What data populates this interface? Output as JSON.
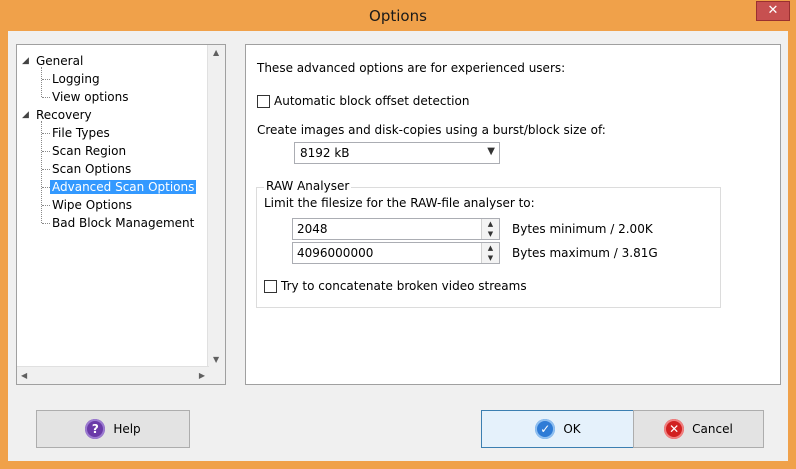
{
  "window": {
    "title": "Options",
    "close_glyph": "✕"
  },
  "tree": {
    "items": [
      {
        "label": "General",
        "expanded": true
      },
      {
        "label": "Logging"
      },
      {
        "label": "View options"
      },
      {
        "label": "Recovery",
        "expanded": true
      },
      {
        "label": "File Types"
      },
      {
        "label": "Scan Region"
      },
      {
        "label": "Scan Options"
      },
      {
        "label": "Advanced Scan Options",
        "selected": true
      },
      {
        "label": "Wipe Options"
      },
      {
        "label": "Bad Block Management"
      }
    ]
  },
  "panel": {
    "intro": "These advanced options are for experienced users:",
    "auto_offset": {
      "label": "Automatic block offset detection",
      "checked": false
    },
    "burst_label": "Create images and disk-copies using a burst/block size of:",
    "burst_value": "8192 kB",
    "raw": {
      "title": "RAW Analyser",
      "limit_label": "Limit the filesize for the RAW-file analyser to:",
      "min_value": "2048",
      "min_label": "Bytes minimum / 2.00K",
      "max_value": "4096000000",
      "max_label": "Bytes maximum / 3.81G",
      "concat": {
        "label": "Try to concatenate broken video streams",
        "checked": false
      }
    }
  },
  "buttons": {
    "help": "Help",
    "ok": "OK",
    "cancel": "Cancel"
  },
  "icons": {
    "help": "help-icon",
    "ok": "ok-check-icon",
    "cancel": "cancel-x-icon"
  }
}
